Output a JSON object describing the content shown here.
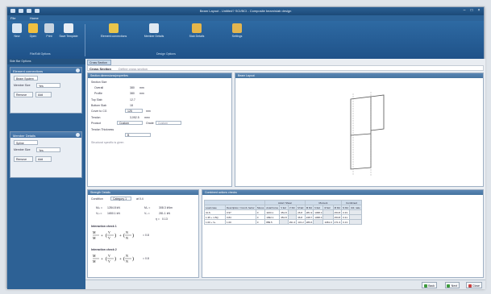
{
  "window": {
    "title": "Beam Layout - Untitled? SCI/BCI - Composite beam/slab design"
  },
  "menu": {
    "items": [
      "File",
      "Home"
    ]
  },
  "ribbon": {
    "buttons": [
      {
        "label": "New"
      },
      {
        "label": "Open"
      },
      {
        "label": "Print"
      },
      {
        "label": "Save Template"
      },
      {
        "label": "Element connections"
      },
      {
        "label": "Member Details"
      },
      {
        "label": "Slab Details"
      },
      {
        "label": "Settings"
      }
    ],
    "groups": [
      "File/Edit Options",
      "Design Options"
    ]
  },
  "left": {
    "header": "Side Bar Options",
    "card1": {
      "title": "Element connections",
      "row1": "Beam System",
      "row2_label": "Member Size",
      "row2_value": "Yes",
      "btn1": "Remove",
      "btn2": "Add"
    },
    "card2": {
      "title": "Member Details",
      "row1": "Spline",
      "row2_label": "Member Size",
      "row2_value": "Yes",
      "btn1": "Remove",
      "btn2": "Add"
    }
  },
  "doc": {
    "tab": "Cross Section",
    "name": "Cross Section",
    "name_hint": "Define cross section"
  },
  "props": {
    "title": "Section dimensions/properties",
    "rows": [
      {
        "label": "Section Size",
        "value": "",
        "unit": ""
      },
      {
        "label": "Overall",
        "value": "380",
        "unit": "mm"
      },
      {
        "label": "Profile",
        "value": "380",
        "unit": "mm"
      },
      {
        "label": "Top Slab",
        "value": "12.7",
        "unit": ""
      },
      {
        "label": "Bottom Slab",
        "value": "18",
        "unit": ""
      },
      {
        "label": "Cover to CG",
        "value": "125",
        "unit": "mm"
      },
      {
        "label": "Tendon",
        "value": "3,052.5",
        "unit": "mm²"
      },
      {
        "label": "Product",
        "value": "Custom",
        "unit": "Grade"
      },
      {
        "label": "Tendon Thickness",
        "value": "B",
        "unit": ""
      }
    ],
    "grade_placeholder": "Custom",
    "note": "Structural specific is given"
  },
  "view": {
    "title": "Beam Layout"
  },
  "strength": {
    "title": "Strength Details",
    "row_label": "Condition",
    "row_select": "Category 1",
    "row_extra": "at 0.4",
    "lines": [
      {
        "l": "Mₚₗ =",
        "v": "1284.8 kN",
        "r": "Mᵤ =",
        "rv": "308.3 kNm"
      },
      {
        "l": "Vₚₗ =",
        "v": "1650.1 kN",
        "r": "Vᵤ =",
        "rv": "281.1 kN"
      },
      {
        "l": "",
        "v": "",
        "r": "η =",
        "rv": "0.13"
      }
    ],
    "check1_title": "Interaction check 1",
    "check1_result": "= 0.8",
    "check2_title": "Interaction check 2",
    "check2_result": "= 0.8"
  },
  "combined": {
    "title": "Combined actions checks",
    "group_headers": [
      "Axial / Shear",
      "Moment",
      "Combined"
    ],
    "col_headers": [
      "Load case",
      "Description / Comb. factor",
      "Stress",
      "Axial Force",
      "V Ed",
      "V Rd",
      "M Ed",
      "M Rd",
      "N Ed",
      "M Ed",
      "M Rd",
      "N Rd",
      "Util. ratio",
      "Shear ratio"
    ],
    "rows": [
      [
        "ULS",
        "0.97",
        "0",
        "1163.1",
        "351.8",
        "",
        "26.8",
        "281.9",
        "1068.3",
        "",
        "253.8",
        "0.33",
        ""
      ],
      [
        "1.35 + 1.5Q",
        "0.84",
        "0",
        "1092.1",
        "351.8",
        "",
        "36.8",
        "248.7",
        "1068.3",
        "",
        "253.8",
        "0.31",
        ""
      ],
      [
        "1.00 + Vₑ",
        "1.00",
        "0",
        "889.5",
        "",
        "291.3",
        "131.2",
        "289.6",
        "",
        "1081.0",
        "271.3",
        "0.13",
        ""
      ]
    ]
  },
  "footer": {
    "buttons": [
      "Back",
      "Next",
      "Close"
    ]
  },
  "colors": {
    "ribbon": "#2e6aa3",
    "panel_header": "#4f7fb0",
    "sidebar": "#2d6195"
  }
}
